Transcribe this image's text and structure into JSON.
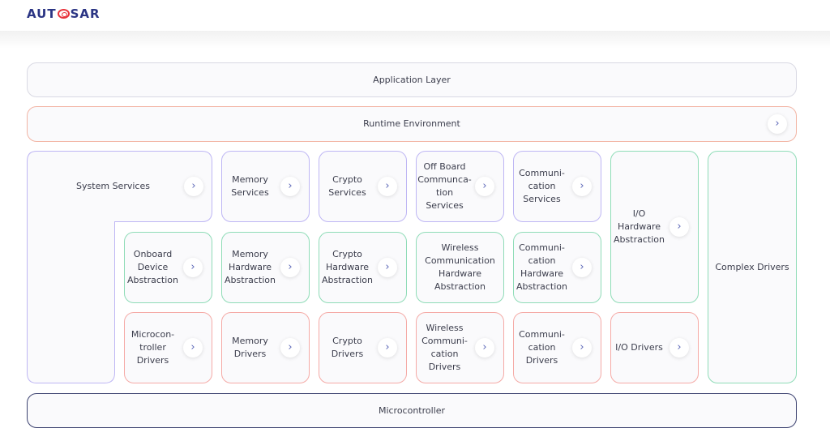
{
  "logo": {
    "text": "AUTOSAR",
    "left": "AUT",
    "right": "SAR"
  },
  "colors": {
    "services": "#beb6f4",
    "abstraction": "#8fdcb7",
    "drivers": "#f5aaa6",
    "microcontroller": "#3c4270",
    "logo": "#2b3584",
    "logo_accent": "#e8343c"
  },
  "layers": {
    "application": "Application Layer",
    "runtime": "Runtime Environment",
    "microcontroller": "Microcontroller",
    "complex_drivers": "Complex Drivers",
    "system_services": "System Services"
  },
  "modules": [
    {
      "label": "Memory\nServices"
    },
    {
      "label": "Crypto\nServices"
    },
    {
      "label": "Off Board\nCommunca-\ntion\nServices"
    },
    {
      "label": "Communi-\ncation\nServices"
    },
    {
      "label": "I/O\nHardware\nAbstraction"
    },
    {
      "label": "Onboard\nDevice\nAbstraction"
    },
    {
      "label": "Memory\nHardware\nAbstraction"
    },
    {
      "label": "Crypto\nHardware\nAbstraction"
    },
    {
      "label": "Wireless\nCommunication\nHardware\nAbstraction"
    },
    {
      "label": "Communi-\ncation\nHardware\nAbstraction"
    },
    {
      "label": "Microcon-\ntroller\nDrivers"
    },
    {
      "label": "Memory\nDrivers"
    },
    {
      "label": "Crypto\nDrivers"
    },
    {
      "label": "Wireless\nCommuni-\ncation\nDrivers"
    },
    {
      "label": "Communi-\ncation\nDrivers"
    },
    {
      "label": "I/O Drivers"
    }
  ],
  "chevron": "›"
}
